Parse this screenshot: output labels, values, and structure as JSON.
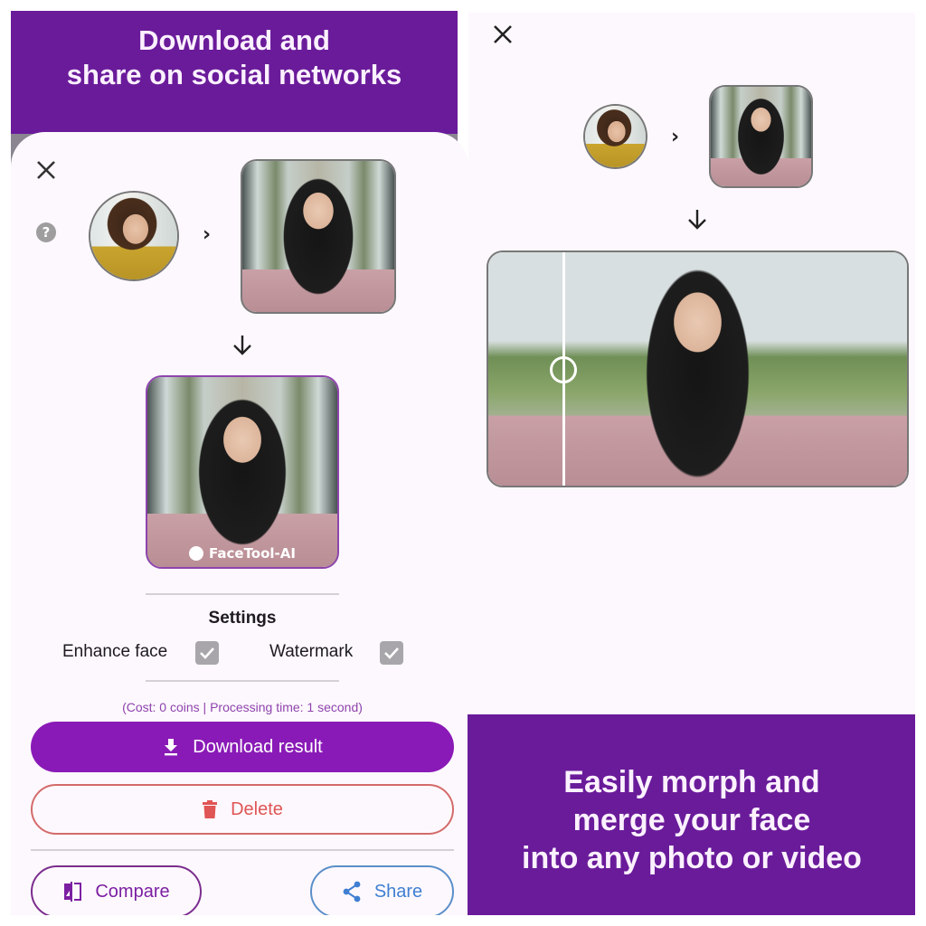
{
  "left_panel": {
    "banner": {
      "line1": "Download and",
      "line2": "share on social networks"
    },
    "icons": {
      "close": "close-icon",
      "help": "help-icon",
      "help_glyph": "?",
      "chevron": "›",
      "arrow_down": "arrow-down-icon"
    },
    "result": {
      "watermark_text": "FaceTool-AI"
    },
    "settings": {
      "title": "Settings",
      "options": [
        {
          "label": "Enhance face",
          "checked": true
        },
        {
          "label": "Watermark",
          "checked": true
        }
      ]
    },
    "cost_text": "(Cost: 0 coins | Processing time: 1 second)",
    "buttons": {
      "download": "Download result",
      "delete": "Delete",
      "compare": "Compare",
      "share": "Share"
    }
  },
  "right_panel": {
    "compare_slider_position": 0.18,
    "banner": {
      "line1": "Easily morph and",
      "line2": "merge your face",
      "line3": "into any photo or video"
    }
  },
  "colors": {
    "brand_purple": "#6a1b9a",
    "button_purple": "#8a1ab7",
    "delete_red": "#e05555",
    "share_blue": "#3f7fd2"
  }
}
